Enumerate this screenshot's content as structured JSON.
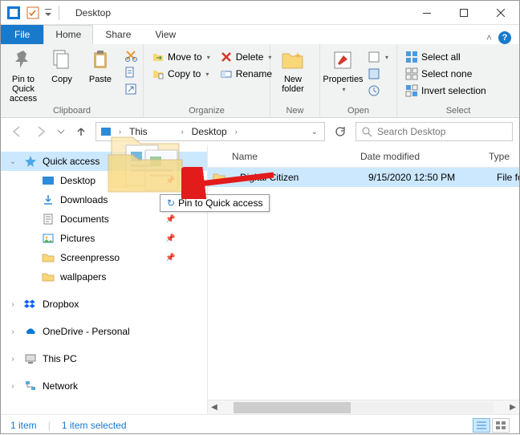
{
  "window": {
    "title": "Desktop"
  },
  "tabs": {
    "file": "File",
    "home": "Home",
    "share": "Share",
    "view": "View"
  },
  "ribbon": {
    "pin": "Pin to Quick\naccess",
    "copy": "Copy",
    "paste": "Paste",
    "clipboard_group": "Clipboard",
    "moveto": "Move to",
    "copyto": "Copy to",
    "delete": "Delete",
    "rename": "Rename",
    "organize_group": "Organize",
    "newfolder": "New\nfolder",
    "new_group": "New",
    "properties": "Properties",
    "open_group": "Open",
    "selectall": "Select all",
    "selectnone": "Select none",
    "invert": "Invert selection",
    "select_group": "Select"
  },
  "address": {
    "seg1": "This ",
    "seg2": "Desktop",
    "search_placeholder": "Search Desktop"
  },
  "nav": {
    "quick": "Quick access",
    "desktop": "Desktop",
    "downloads": "Downloads",
    "documents": "Documents",
    "pictures": "Pictures",
    "screenpresso": "Screenpresso",
    "wallpapers": "wallpapers",
    "dropbox": "Dropbox",
    "onedrive": "OneDrive - Personal",
    "thispc": "This PC",
    "network": "Network"
  },
  "columns": {
    "name": "Name",
    "date": "Date modified",
    "type": "Type"
  },
  "files": [
    {
      "name": "Digital Citizen",
      "date": "9/15/2020 12:50 PM",
      "type": "File fold"
    }
  ],
  "drag": {
    "tooltip": "Pin to Quick access"
  },
  "status": {
    "count": "1 item",
    "selected": "1 item selected"
  }
}
